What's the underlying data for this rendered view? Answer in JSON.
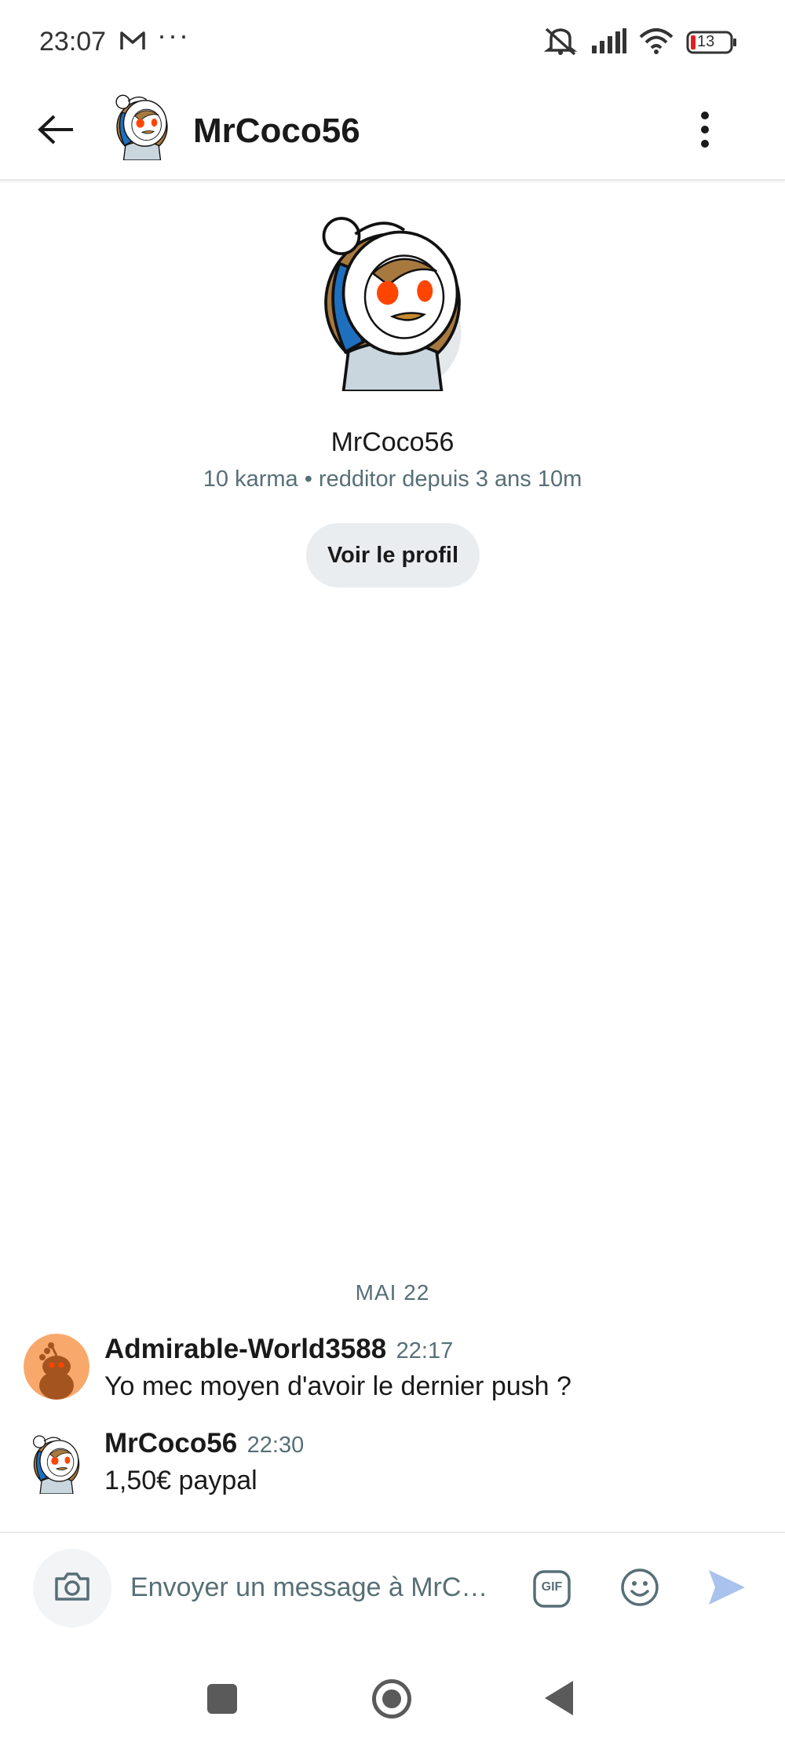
{
  "status_bar": {
    "time": "23:07",
    "overflow": "···",
    "battery": "13",
    "icons": [
      "gmail-icon",
      "mute-icon",
      "signal-icon",
      "wifi-icon",
      "battery-icon"
    ]
  },
  "header": {
    "title": "MrCoco56",
    "icons": [
      "back-arrow-icon",
      "avatar",
      "more-vertical-icon"
    ]
  },
  "profile": {
    "username": "MrCoco56",
    "meta": "10 karma • redditor depuis 3 ans 10m",
    "button_label": "Voir le profil"
  },
  "conversation": {
    "date_label": "MAI 22",
    "messages": [
      {
        "author": "Admirable-World3588",
        "time": "22:17",
        "text": "Yo mec moyen d'avoir le dernier push ?"
      },
      {
        "author": "MrCoco56",
        "time": "22:30",
        "text": "1,50€ paypal"
      }
    ]
  },
  "composer": {
    "placeholder": "Envoyer un message à MrC…",
    "icons": [
      "camera-icon",
      "gif-icon",
      "emoji-icon",
      "send-icon"
    ],
    "gif_label": "GIF"
  },
  "colors": {
    "meta_text": "#576f76",
    "button_bg": "#eaedef",
    "send": "#a9c2ee",
    "snoo_orange": "#ff4500",
    "avatar_blue": "#1f6fbf",
    "default_avatar_bg": "#f8a86a"
  }
}
